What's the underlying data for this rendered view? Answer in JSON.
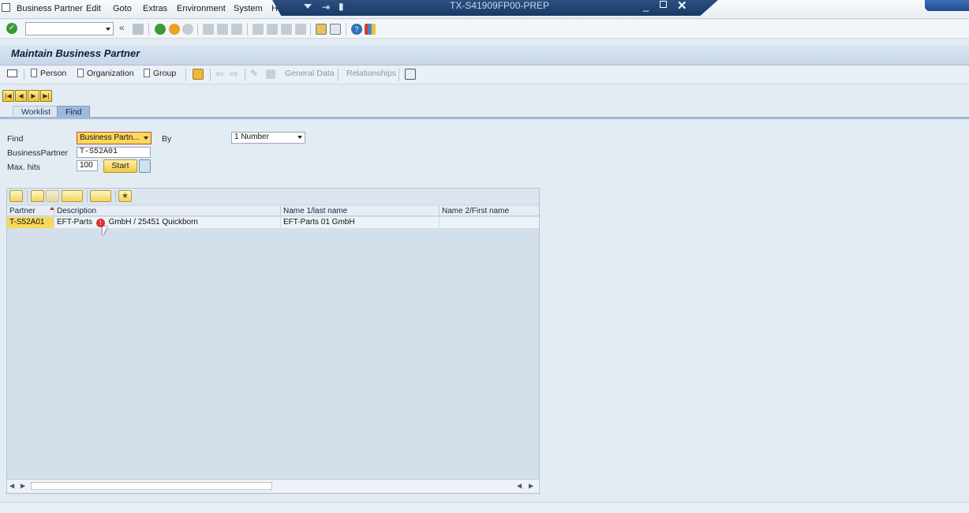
{
  "menu": {
    "items": [
      "Business Partner",
      "Edit",
      "Goto",
      "Extras",
      "Environment",
      "System",
      "H"
    ]
  },
  "window": {
    "title": "TX-S41909FP00-PREP"
  },
  "app": {
    "title": "Maintain Business Partner"
  },
  "app_toolbar": {
    "person": "Person",
    "organization": "Organization",
    "group": "Group",
    "general_data": "General Data",
    "relationships": "Relationships"
  },
  "tabs": {
    "worklist": "Worklist",
    "find": "Find"
  },
  "find_form": {
    "find_label": "Find",
    "find_value": "Business Partn...",
    "by_label": "By",
    "by_value": "1 Number",
    "bp_label": "BusinessPartner",
    "bp_value": "T-S52A01",
    "maxhits_label": "Max. hits",
    "maxhits_value": "100",
    "start_label": "Start"
  },
  "grid": {
    "columns": [
      "Partner",
      "Description",
      "Name 1/last name",
      "Name 2/First name"
    ],
    "rows": [
      {
        "partner": "T-S52A01",
        "description": "EFT-Parts",
        "description_rest": "GmbH / 25451 Quickborn",
        "name1": "EFT-Parts 01 GmbH",
        "name2": ""
      }
    ]
  },
  "colors": {
    "accent": "#1e4c8f",
    "selected": "#f9d95a",
    "background": "#e3ebf3"
  }
}
